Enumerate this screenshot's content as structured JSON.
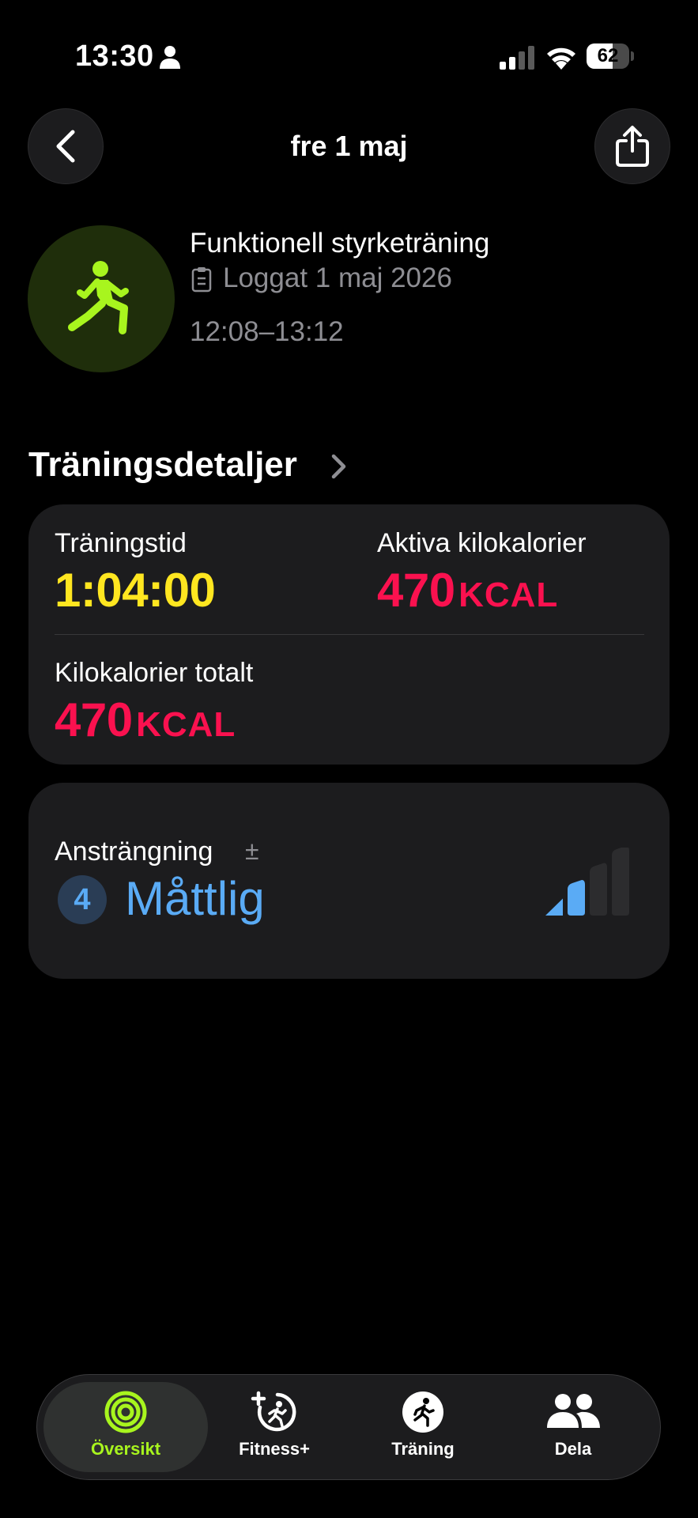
{
  "status_bar": {
    "time": "13:30",
    "battery": "62",
    "battery_level": 0.62
  },
  "header": {
    "title": "fre 1 maj",
    "back_icon": "chevron-left-icon",
    "share_icon": "share-icon"
  },
  "workout": {
    "name": "Funktionell styrketräning",
    "logged": "Loggat 1 maj 2026",
    "time_range": "12:08–13:12",
    "accent_color": "#a8f51e"
  },
  "section": {
    "title": "Träningsdetaljer"
  },
  "details": {
    "duration_label": "Träningstid",
    "duration_value": "1:04:00",
    "active_label": "Aktiva kilokalorier",
    "active_value": "470",
    "active_unit": "KCAL",
    "total_label": "Kilokalorier totalt",
    "total_value": "470",
    "total_unit": "KCAL",
    "colors": {
      "duration": "#ffe620",
      "calories": "#fa114f"
    }
  },
  "effort": {
    "label": "Ansträngning",
    "sign": "±",
    "level": "4",
    "value": "Måttlig",
    "bars_filled": 2,
    "bars_total": 4,
    "color": "#5aabf5"
  },
  "tabs": [
    {
      "label": "Översikt",
      "icon": "activity-rings-icon",
      "active": true
    },
    {
      "label": "Fitness+",
      "icon": "fitness-plus-icon",
      "active": false
    },
    {
      "label": "Träning",
      "icon": "running-figure-icon",
      "active": false
    },
    {
      "label": "Dela",
      "icon": "people-icon",
      "active": false
    }
  ]
}
